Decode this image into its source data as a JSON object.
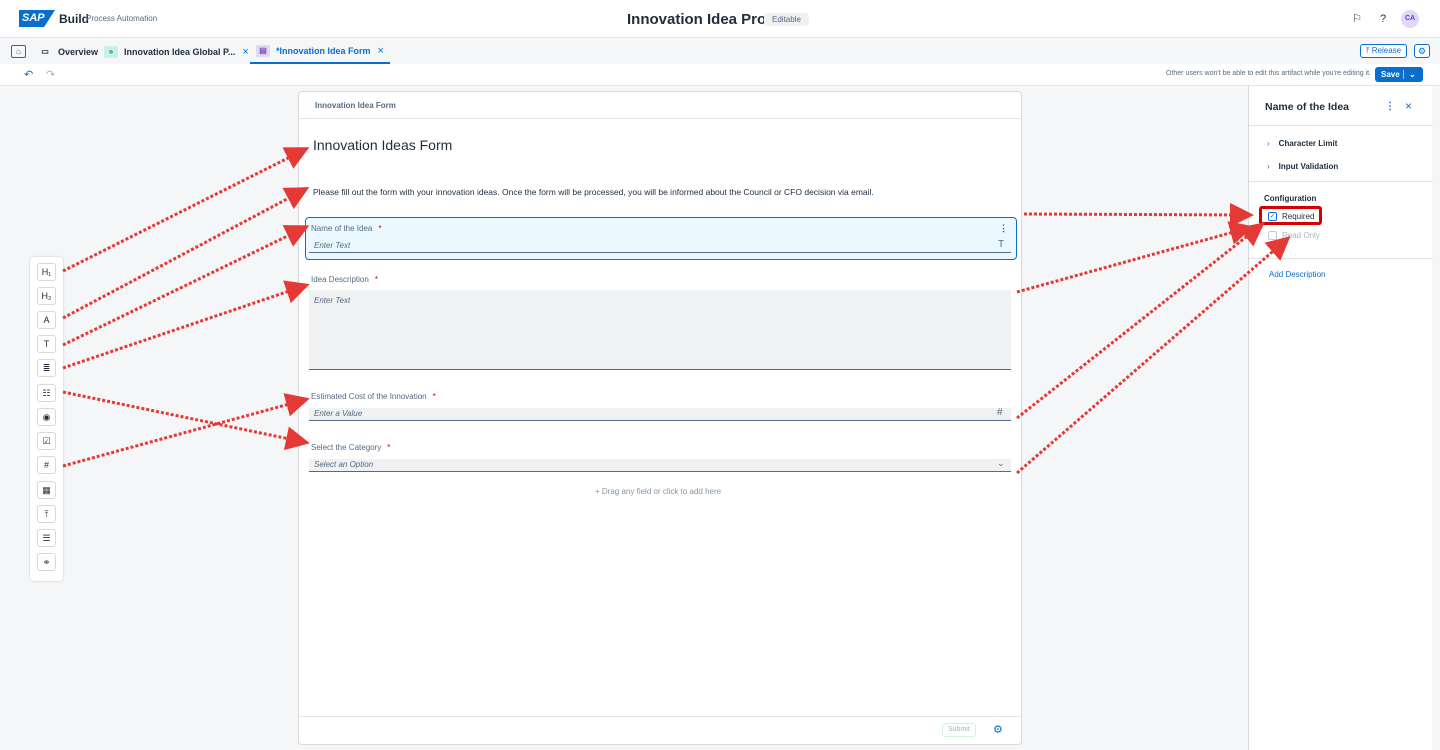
{
  "shell": {
    "logo_text": "SAP",
    "product": "Build",
    "product_sub": "Process Automation",
    "title": "Innovation Idea Process",
    "badge": "Editable",
    "avatar": "CA"
  },
  "tabs": [
    {
      "label": "Overview",
      "icon": "folder-icon"
    },
    {
      "label": "Innovation Idea Global P...",
      "icon": "process-icon"
    },
    {
      "label": "*Innovation Idea Form",
      "icon": "form-icon"
    }
  ],
  "toolbar": {
    "release": "Release",
    "edit_note": "Other users won't be able to edit this artifact while you're editing it.",
    "save": "Save"
  },
  "palette": [
    {
      "name": "heading1",
      "glyph": "H₁"
    },
    {
      "name": "heading2",
      "glyph": "H₂"
    },
    {
      "name": "paragraph",
      "glyph": "A"
    },
    {
      "name": "text",
      "glyph": "T"
    },
    {
      "name": "textarea",
      "glyph": "≣"
    },
    {
      "name": "list",
      "glyph": "☷"
    },
    {
      "name": "radio",
      "glyph": "◉"
    },
    {
      "name": "checkbox",
      "glyph": "☑"
    },
    {
      "name": "number",
      "glyph": "#"
    },
    {
      "name": "date",
      "glyph": "▦"
    },
    {
      "name": "upload",
      "glyph": "⤒"
    },
    {
      "name": "table",
      "glyph": "☰"
    },
    {
      "name": "link",
      "glyph": "⚭"
    }
  ],
  "form": {
    "header": "Innovation Idea Form",
    "title": "Innovation Ideas Form",
    "description": "Please fill out the form with your innovation ideas. Once the form will be processed, you will be informed about the Council or CFO decision via email.",
    "fields": {
      "name": {
        "label": "Name of the Idea",
        "required": "*",
        "placeholder": "Enter Text"
      },
      "description": {
        "label": "Idea Description",
        "required": "*",
        "placeholder": "Enter Text"
      },
      "cost": {
        "label": "Estimated Cost of the Innovation",
        "required": "*",
        "placeholder": "Enter a Value"
      },
      "category": {
        "label": "Select the Category",
        "required": "*",
        "placeholder": "Select an Option"
      }
    },
    "dropzone": "Drag any field or click to add here",
    "submit": "Submit"
  },
  "panel": {
    "title": "Name of the Idea",
    "sections": [
      "Character Limit",
      "Input Validation"
    ],
    "config_label": "Configuration",
    "required_label": "Required",
    "readonly_label": "Read Only",
    "add_description": "Add Description"
  },
  "colors": {
    "accent": "#0a6ed1",
    "highlight": "#d40000",
    "arrow": "#e53935"
  }
}
